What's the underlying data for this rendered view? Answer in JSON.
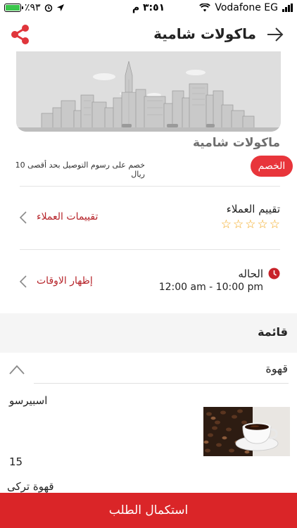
{
  "status_bar": {
    "battery_percent": "٪٩٣",
    "time": "٣:٥١ م",
    "carrier": "Vodafone EG"
  },
  "header": {
    "title": "ماكولات شامية",
    "share_icon": "share-icon",
    "back_icon": "arrow-right-icon"
  },
  "restaurant": {
    "name": "ماكولات شامية",
    "discount_badge": "الخصم",
    "discount_text": "خصم على رسوم التوصيل بحد أقصى 10 ريال"
  },
  "reviews": {
    "title": "تقييم العملاء",
    "stars": "☆☆☆☆☆",
    "rating": 0,
    "link": "تقييمات العملاء"
  },
  "status": {
    "title": "الحاله",
    "hours": "12:00 am - 10:00 pm",
    "link": "إظهار الاوقات"
  },
  "menu": {
    "title": "قائمة",
    "category": "قهوة",
    "items": [
      {
        "name": "اسبيرسو",
        "price": "15"
      },
      {
        "name": "قهوة تركى"
      }
    ]
  },
  "cta": {
    "label": "استكمال الطلب"
  },
  "colors": {
    "brand_red": "#da2528",
    "star": "#f2a516"
  }
}
